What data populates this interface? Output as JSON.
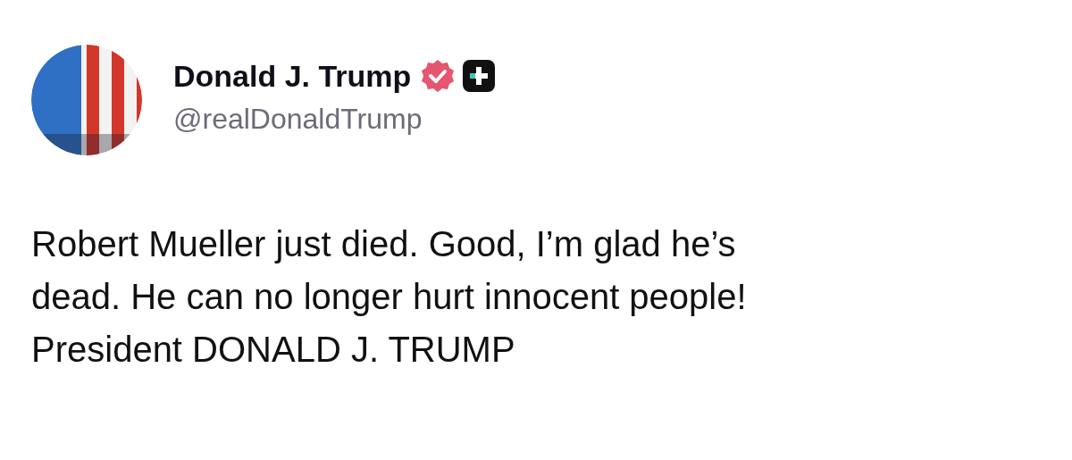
{
  "author": {
    "name": "Donald J. Trump",
    "verified": true,
    "handle": "@realDonaldTrump"
  },
  "post": {
    "lines": [
      "Robert Mueller just died. Good, I’m glad he’s",
      "dead. He can no longer hurt innocent people!",
      "President DONALD J. TRUMP"
    ]
  }
}
